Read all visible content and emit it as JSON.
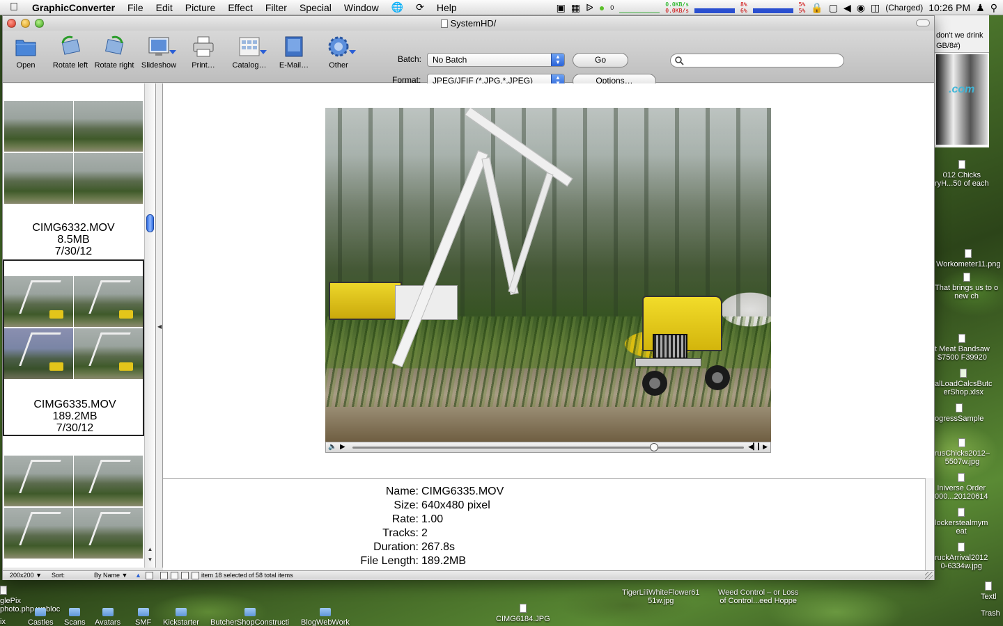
{
  "menubar": {
    "app_name": "GraphicConverter",
    "items": [
      "File",
      "Edit",
      "Picture",
      "Effect",
      "Filter",
      "Special",
      "Window",
      "Help"
    ],
    "net_up": "0.0KB/s",
    "net_down": "0.0KB/s",
    "cpu_top": "8%",
    "cpu_bottom": "6%",
    "cpu2_top": "5%",
    "cpu2_bottom": "5%",
    "battery": "(Charged)",
    "clock": "10:26 PM",
    "counter": "0"
  },
  "window": {
    "title": "SystemHD/"
  },
  "toolbar": {
    "open": "Open",
    "rotate_left": "Rotate left",
    "rotate_right": "Rotate right",
    "slideshow": "Slideshow",
    "print": "Print…",
    "catalog": "Catalog…",
    "email": "E-Mail…",
    "other": "Other",
    "batch_label": "Batch:",
    "batch_value": "No Batch",
    "go": "Go",
    "format_label": "Format:",
    "format_value": "JPEG/JFIF (*.JPG,*.JPEG)",
    "options": "Options…",
    "search_placeholder": ""
  },
  "browser": {
    "cells": [
      {
        "name": "CIMG6332.MOV",
        "size": "8.5MB",
        "date": "7/30/12",
        "selected": false
      },
      {
        "name": "CIMG6335.MOV",
        "size": "189.2MB",
        "date": "7/30/12",
        "selected": true
      }
    ]
  },
  "player": {
    "progress": 0.77
  },
  "info": {
    "rows": [
      {
        "key": "Name:",
        "value": "CIMG6335.MOV"
      },
      {
        "key": "Size:",
        "value": "640x480 pixel"
      },
      {
        "key": "Rate:",
        "value": "1.00"
      },
      {
        "key": "Tracks:",
        "value": "2"
      },
      {
        "key": "Duration:",
        "value": "267.8s"
      },
      {
        "key": "File Length:",
        "value": "189.2MB"
      }
    ]
  },
  "status": {
    "thumb_size": "200x200",
    "sort_label": "Sort:",
    "sort_value": "By Name",
    "selection": "item 18 selected of 58 total items"
  },
  "desktop": {
    "right_items": [
      "don't we drink",
      "GB/8#)",
      ".com",
      "012 Chicks",
      "ryH...50 of each",
      "Workometer11.png",
      "That brings us to o",
      "new ch",
      "t Meat Bandsaw",
      "$7500 F39920",
      "alLoadCalcsButc",
      "erShop.xlsx",
      "ogressSample",
      "rusChicks2012–",
      "5507w.jpg",
      "Iniverse Order",
      "000...20120614",
      "lockerstealmym",
      "eat",
      "ruckArrival2012",
      "0-6334w.jpg",
      "Textl",
      "Trash"
    ],
    "bottom_items": [
      "glePix",
      "photo.php.webloc",
      "Castles",
      "Scans",
      "Avatars",
      "SMF",
      "Kickstarter",
      "ButcherShopConstructi",
      "BlogWebWork",
      "CIMG6184.JPG",
      "TigerLiliWhiteFlower61",
      "51w.jpg",
      "Weed Control – or Loss",
      "of Control...eed Hoppe",
      "ix"
    ]
  }
}
